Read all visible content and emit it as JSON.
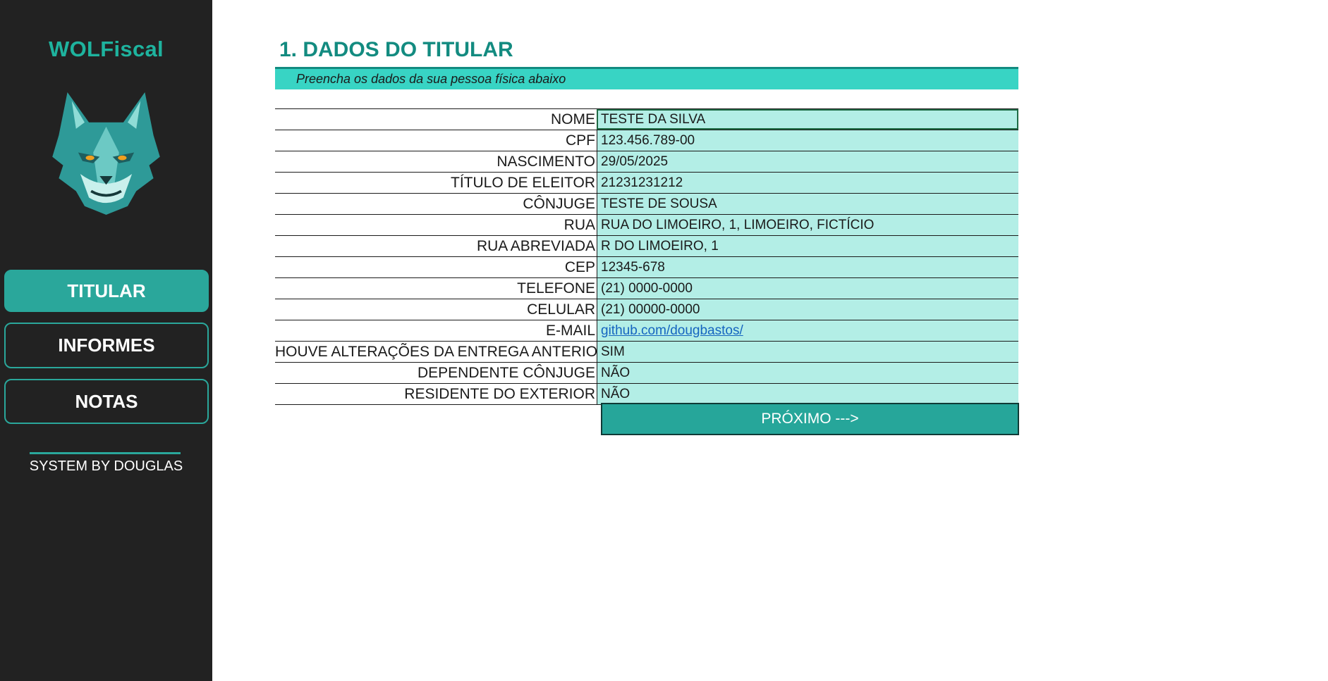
{
  "sidebar": {
    "brand": "WOLFiscal",
    "logo_icon": "wolf-logo-icon",
    "nav": [
      {
        "label": "TITULAR",
        "active": true
      },
      {
        "label": "INFORMES",
        "active": false
      },
      {
        "label": "NOTAS",
        "active": false
      }
    ],
    "signature": "SYSTEM BY DOUGLAS"
  },
  "main": {
    "title": "1. DADOS DO TITULAR",
    "subtitle": "Preencha os dados da sua pessoa física abaixo",
    "fields": [
      {
        "label": "NOME",
        "value": "TESTE DA SILVA"
      },
      {
        "label": "CPF",
        "value": "123.456.789-00"
      },
      {
        "label": "NASCIMENTO",
        "value": "29/05/2025"
      },
      {
        "label": "TÍTULO DE ELEITOR",
        "value": "21231231212"
      },
      {
        "label": "CÔNJUGE",
        "value": "TESTE DE SOUSA"
      },
      {
        "label": "RUA",
        "value": "RUA DO LIMOEIRO, 1, LIMOEIRO, FICTÍCIO"
      },
      {
        "label": "RUA ABREVIADA",
        "value": "R DO LIMOEIRO, 1"
      },
      {
        "label": "CEP",
        "value": "12345-678"
      },
      {
        "label": "TELEFONE",
        "value": "(21) 0000-0000"
      },
      {
        "label": "CELULAR",
        "value": "(21) 00000-0000"
      },
      {
        "label": "E-MAIL",
        "value": "github.com/dougbastos/"
      },
      {
        "label": "HOUVE ALTERAÇÕES DA ENTREGA ANTERIOR",
        "value": "SIM"
      },
      {
        "label": "DEPENDENTE CÔNJUGE",
        "value": "NÃO"
      },
      {
        "label": "RESIDENTE DO EXTERIOR",
        "value": "NÃO"
      }
    ],
    "next_label": "PRÓXIMO --->"
  },
  "colors": {
    "sidebar_bg": "#222222",
    "accent": "#2aa79b",
    "title": "#138b80",
    "banner": "#38d4c4",
    "cell": "#b3eee6",
    "link": "#1565c0"
  }
}
